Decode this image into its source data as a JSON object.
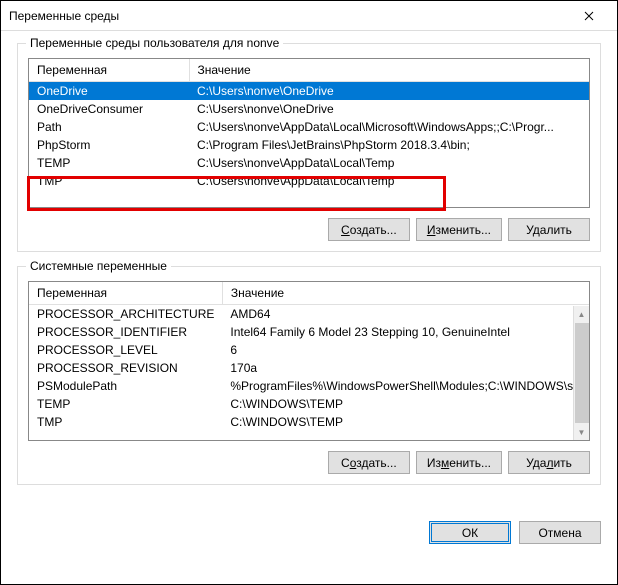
{
  "titlebar": {
    "title": "Переменные среды"
  },
  "user_section": {
    "legend": "Переменные среды пользователя для nonve",
    "columns": {
      "name": "Переменная",
      "value": "Значение"
    },
    "rows": [
      {
        "name": "OneDrive",
        "value": "C:\\Users\\nonve\\OneDrive",
        "selected": true
      },
      {
        "name": "OneDriveConsumer",
        "value": "C:\\Users\\nonve\\OneDrive",
        "selected": false
      },
      {
        "name": "Path",
        "value": "C:\\Users\\nonve\\AppData\\Local\\Microsoft\\WindowsApps;;C:\\Progr...",
        "selected": false
      },
      {
        "name": "PhpStorm",
        "value": "C:\\Program Files\\JetBrains\\PhpStorm 2018.3.4\\bin;",
        "selected": false
      },
      {
        "name": "TEMP",
        "value": "C:\\Users\\nonve\\AppData\\Local\\Temp",
        "selected": false
      },
      {
        "name": "TMP",
        "value": "C:\\Users\\nonve\\AppData\\Local\\Temp",
        "selected": false
      }
    ],
    "buttons": {
      "create": "Создать...",
      "edit": "Изменить...",
      "delete": "Удалить"
    }
  },
  "system_section": {
    "legend": "Системные переменные",
    "columns": {
      "name": "Переменная",
      "value": "Значение"
    },
    "rows": [
      {
        "name": "PROCESSOR_ARCHITECTURE",
        "value": "AMD64"
      },
      {
        "name": "PROCESSOR_IDENTIFIER",
        "value": "Intel64 Family 6 Model 23 Stepping 10, GenuineIntel"
      },
      {
        "name": "PROCESSOR_LEVEL",
        "value": "6"
      },
      {
        "name": "PROCESSOR_REVISION",
        "value": "170a"
      },
      {
        "name": "PSModulePath",
        "value": "%ProgramFiles%\\WindowsPowerShell\\Modules;C:\\WINDOWS\\syst..."
      },
      {
        "name": "TEMP",
        "value": "C:\\WINDOWS\\TEMP"
      },
      {
        "name": "TMP",
        "value": "C:\\WINDOWS\\TEMP"
      }
    ],
    "buttons": {
      "create": "Создать...",
      "edit": "Изменить...",
      "delete": "Удалить"
    }
  },
  "dialog_buttons": {
    "ok": "ОК",
    "cancel": "Отмена"
  }
}
